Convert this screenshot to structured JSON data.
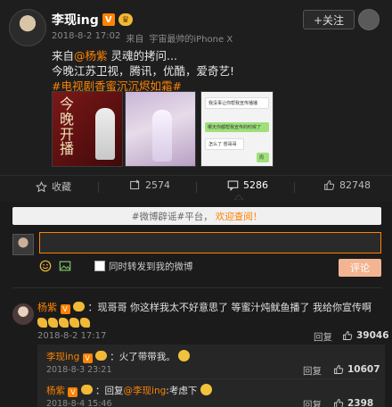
{
  "post": {
    "author": "李现ing",
    "follow_label": "+关注",
    "date": "2018-8-2 17:02",
    "source_prefix": "来自",
    "source_device": "宇宙最帅的iPhone X",
    "text_line1_prefix": "来自",
    "text_line1_mention": "@杨紫",
    "text_line1_suffix": " 灵魂的拷问...",
    "text_line2": "今晚江苏卫视，腾讯，优酷，爱奇艺!",
    "hashtag": "#电视剧香蜜沉沉烬如霜#",
    "image1_text": "今晚开播",
    "chat": {
      "b1": "我没事让你帮我宣传播播",
      "b2": "哪天你都帮我宣传的时候了",
      "b3": "怎么了 想哥哥",
      "b4": "周"
    }
  },
  "actions": {
    "favorite": "收藏",
    "repost": "2574",
    "comment": "5286",
    "like": "82748"
  },
  "comment_box": {
    "notice_prefix": "#微博辟谣#平台，",
    "notice_highlight": "欢迎查阅！",
    "input_value": "",
    "checkbox_label": "同时转发到我的微博",
    "submit_label": "评论"
  },
  "comments": [
    {
      "author": "杨紫",
      "text": "：现哥哥 你这样我太不好意思了 等蜜汁炖鱿鱼播了 我给你宣传啊",
      "time": "2018-8-2 17:17",
      "reply_label": "回复",
      "likes": "39046",
      "replies": [
        {
          "author": "李现ing",
          "text": "：火了带带我。",
          "time": "2018-8-3 23:21",
          "reply_label": "回复",
          "likes": "10607"
        },
        {
          "author": "杨紫",
          "text": "：回复",
          "mention": "@李现ing",
          "text_after": ":考虑下",
          "time": "2018-8-4 15:46",
          "reply_label": "回复",
          "likes": "2398"
        }
      ]
    }
  ]
}
